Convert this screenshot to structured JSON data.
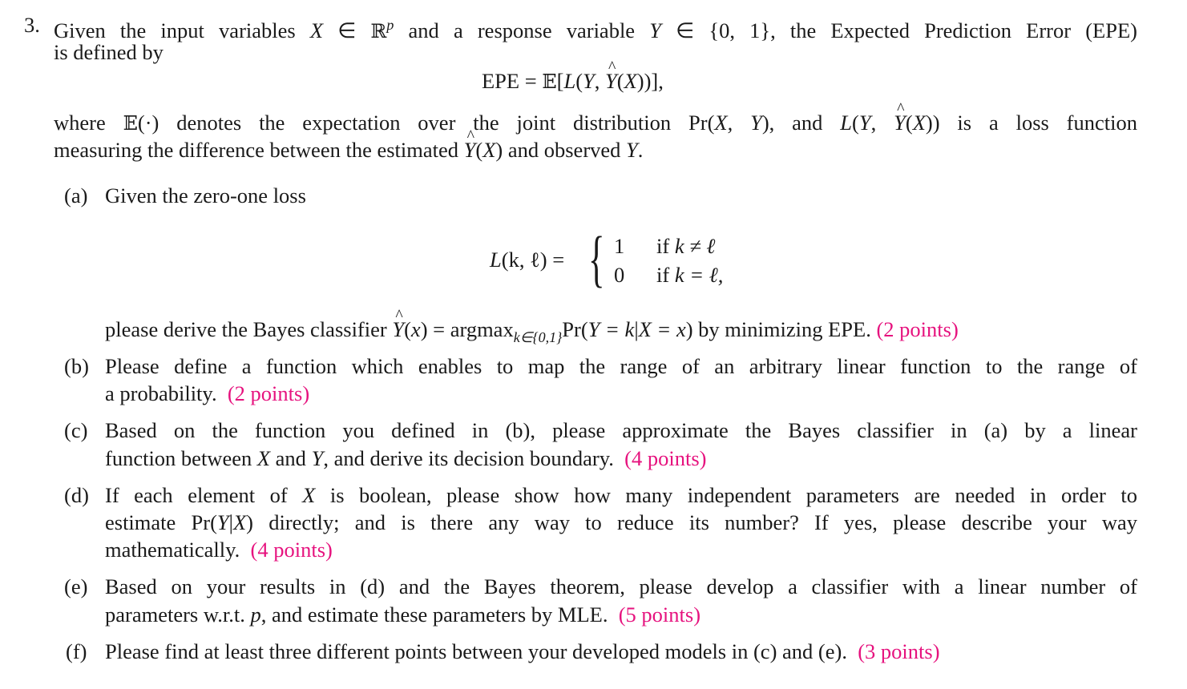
{
  "problem": {
    "number": "3.",
    "intro_line1_a": "Given the input variables ",
    "intro_var_X": "X",
    "intro_in1": " ∈ ",
    "intro_Rp_R": "ℝ",
    "intro_Rp_p": "p",
    "intro_line1_b": " and a response variable ",
    "intro_var_Y": "Y",
    "intro_in2": " ∈ {0, 1}",
    "intro_line1_c": ", the Expected Prediction Error (EPE)",
    "intro_line2": "is defined by",
    "epe_equation": {
      "lhs": "EPE = ",
      "bbE": "𝔼",
      "rhs_open": "[",
      "L": "L",
      "args_open": "(",
      "Y": "Y",
      "comma": ", ",
      "Yhat": "Y",
      "X_open": "(",
      "X": "X",
      "close": "))],"
    },
    "where_line1_a": "where ",
    "where_bbE": "𝔼",
    "where_line1_b": "(·) denotes the expectation over the joint distribution Pr(",
    "where_XY": "X, Y",
    "where_line1_c": "), and ",
    "where_L": "L",
    "where_line1_d": "(",
    "where_Y": "Y",
    "where_comma": ", ",
    "where_Yhat": "Y",
    "where_X_open": "(",
    "where_X": "X",
    "where_line1_e": ")) is a loss function",
    "where_line2_a": "measuring the difference between the estimated ",
    "where_line2_Yhat": "Y",
    "where_line2_b": "(",
    "where_line2_X": "X",
    "where_line2_c": ") and observed ",
    "where_line2_Y": "Y",
    "where_line2_d": "."
  },
  "parts": {
    "a": {
      "label": "(a)",
      "text": "Given the zero-one loss",
      "loss": {
        "lhs_L": "L",
        "lhs_args": "(k, ℓ) =",
        "case1_value": "1",
        "case1_cond_if": "if ",
        "case1_cond": "k ≠ ℓ",
        "case2_value": "0",
        "case2_cond_if": "if ",
        "case2_cond": "k = ℓ,"
      },
      "follow_a": "please derive the Bayes classifier ",
      "follow_Yhat": "Y",
      "follow_b": "(",
      "follow_x": "x",
      "follow_c": ") = argmax",
      "follow_sub": "k∈{0,1}",
      "follow_d": "Pr(",
      "follow_e": "Y = k",
      "follow_f": "|",
      "follow_g": "X = x",
      "follow_h": ") by minimizing EPE. ",
      "points": "(2 points)"
    },
    "b": {
      "label": "(b)",
      "line1": "Please define a function which enables to map the range of an arbitrary linear function to the range of",
      "line2": "a probability.",
      "points": "(2 points)"
    },
    "c": {
      "label": "(c)",
      "line1": "Based on the function you defined in (b), please approximate the Bayes classifier in (a) by a linear",
      "line2_a": "function between ",
      "line2_X": "X",
      "line2_b": " and ",
      "line2_Y": "Y",
      "line2_c": ", and derive its decision boundary.",
      "points": "(4 points)"
    },
    "d": {
      "label": "(d)",
      "line1_a": "If each element of ",
      "line1_X": "X",
      "line1_b": " is boolean, please show how many independent parameters are needed in order to",
      "line2_a": "estimate Pr(",
      "line2_YX": "Y",
      "line2_bar": "|",
      "line2_X": "X",
      "line2_b": ") directly; and is there any way to reduce its number? If yes, please describe your way",
      "line3": "mathematically.",
      "points": "(4 points)"
    },
    "e": {
      "label": "(e)",
      "line1": "Based on your results in (d) and the Bayes theorem, please develop a classifier with a linear number of",
      "line2_a": "parameters w.r.t. ",
      "line2_p": "p",
      "line2_b": ", and estimate these parameters by MLE.",
      "points": "(5 points)"
    },
    "f": {
      "label": "(f)",
      "line1": "Please find at least three different points between your developed models in (c) and (e).",
      "points": "(3 points)"
    }
  },
  "colors": {
    "points_accent": "#e6127e",
    "text": "#1a1a1a",
    "background": "#ffffff"
  }
}
